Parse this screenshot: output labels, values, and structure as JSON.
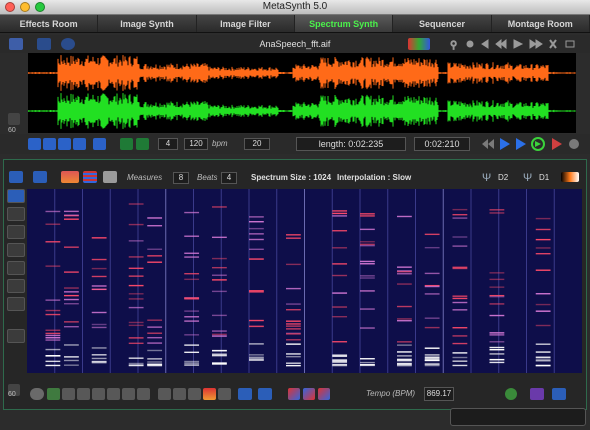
{
  "window": {
    "title": "MetaSynth 5.0"
  },
  "tabs": [
    {
      "label": "Effects Room"
    },
    {
      "label": "Image Synth"
    },
    {
      "label": "Image Filter"
    },
    {
      "label": "Spectrum Synth",
      "active": true
    },
    {
      "label": "Sequencer"
    },
    {
      "label": "Montage Room"
    }
  ],
  "file": {
    "name": "AnaSpeech_fft.aif"
  },
  "transport": {
    "field_a": "4",
    "bpm_value": "120",
    "bpm_label": "bpm",
    "field_b": "20",
    "length": "length: 0:02:235",
    "position": "0:02:210"
  },
  "side_zoom": {
    "top": "60",
    "bottom": "60"
  },
  "spectrum_toolbar": {
    "measures_label": "Measures",
    "measures_value": "8",
    "beats_label": "Beats",
    "beats_value": "4",
    "spectrum_size": "Spectrum Size : 1024",
    "interpolation": "Interpolation : Slow",
    "d2": "D2",
    "d1": "D1"
  },
  "tempo": {
    "label": "Tempo (BPM)",
    "value": "869.17"
  },
  "colors": {
    "accent_green": "#4bf04b",
    "waveform_top": "#ff6a18",
    "waveform_bottom": "#22e022",
    "grid_bg": "#0e0e4a",
    "panel_border": "#2e6a4c"
  },
  "icons": [
    "arrow-tool-icon",
    "grid-icon",
    "chart-icon",
    "stripes-icon",
    "eraser-icon",
    "brush-icon",
    "pencil-icon",
    "line-icon",
    "marquee-icon",
    "hand-icon",
    "play-icon",
    "record-icon",
    "loop-icon",
    "back-icon",
    "speaker-icon",
    "close-icon",
    "gear-icon"
  ]
}
